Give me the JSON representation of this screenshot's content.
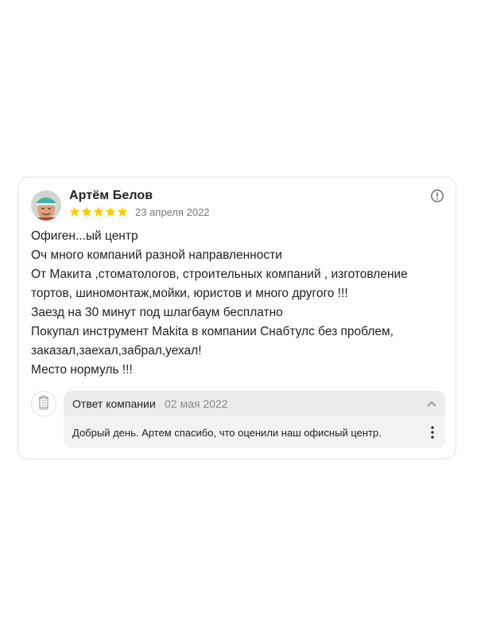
{
  "review": {
    "author": "Артём Белов",
    "rating": 5,
    "rating_max": 5,
    "date": "23 апреля 2022",
    "lines": [
      "Офиген...ый центр",
      "Оч много компаний разной направленности",
      "От Макита ,стоматологов, строительных компаний , изготовление",
      "тортов, шиномонтаж,мойки, юристов и много другого !!!",
      "Заезд на 30 минут под шлагбаум бесплатно",
      "Покупал инструмент Makita в компании Снабтулс без проблем,",
      "заказал,заехал,забрал,уехал!",
      "Место нормуль !!!"
    ]
  },
  "reply": {
    "title": "Ответ компании",
    "date": "02 мая 2022",
    "text": "Добрый день. Артем спасибо, что оценили наш офисный центр."
  },
  "icons": {
    "avatar": "avatar",
    "star": "star-icon",
    "report": "exclamation-circle-icon",
    "company_logo": "company-logo-icon",
    "collapse": "chevron-up-icon",
    "more": "more-vertical-icon"
  },
  "colors": {
    "star": "#fc0",
    "card_border": "#e3e3e3",
    "reply_bg": "#f3f3f3",
    "muted_text": "#888888"
  }
}
